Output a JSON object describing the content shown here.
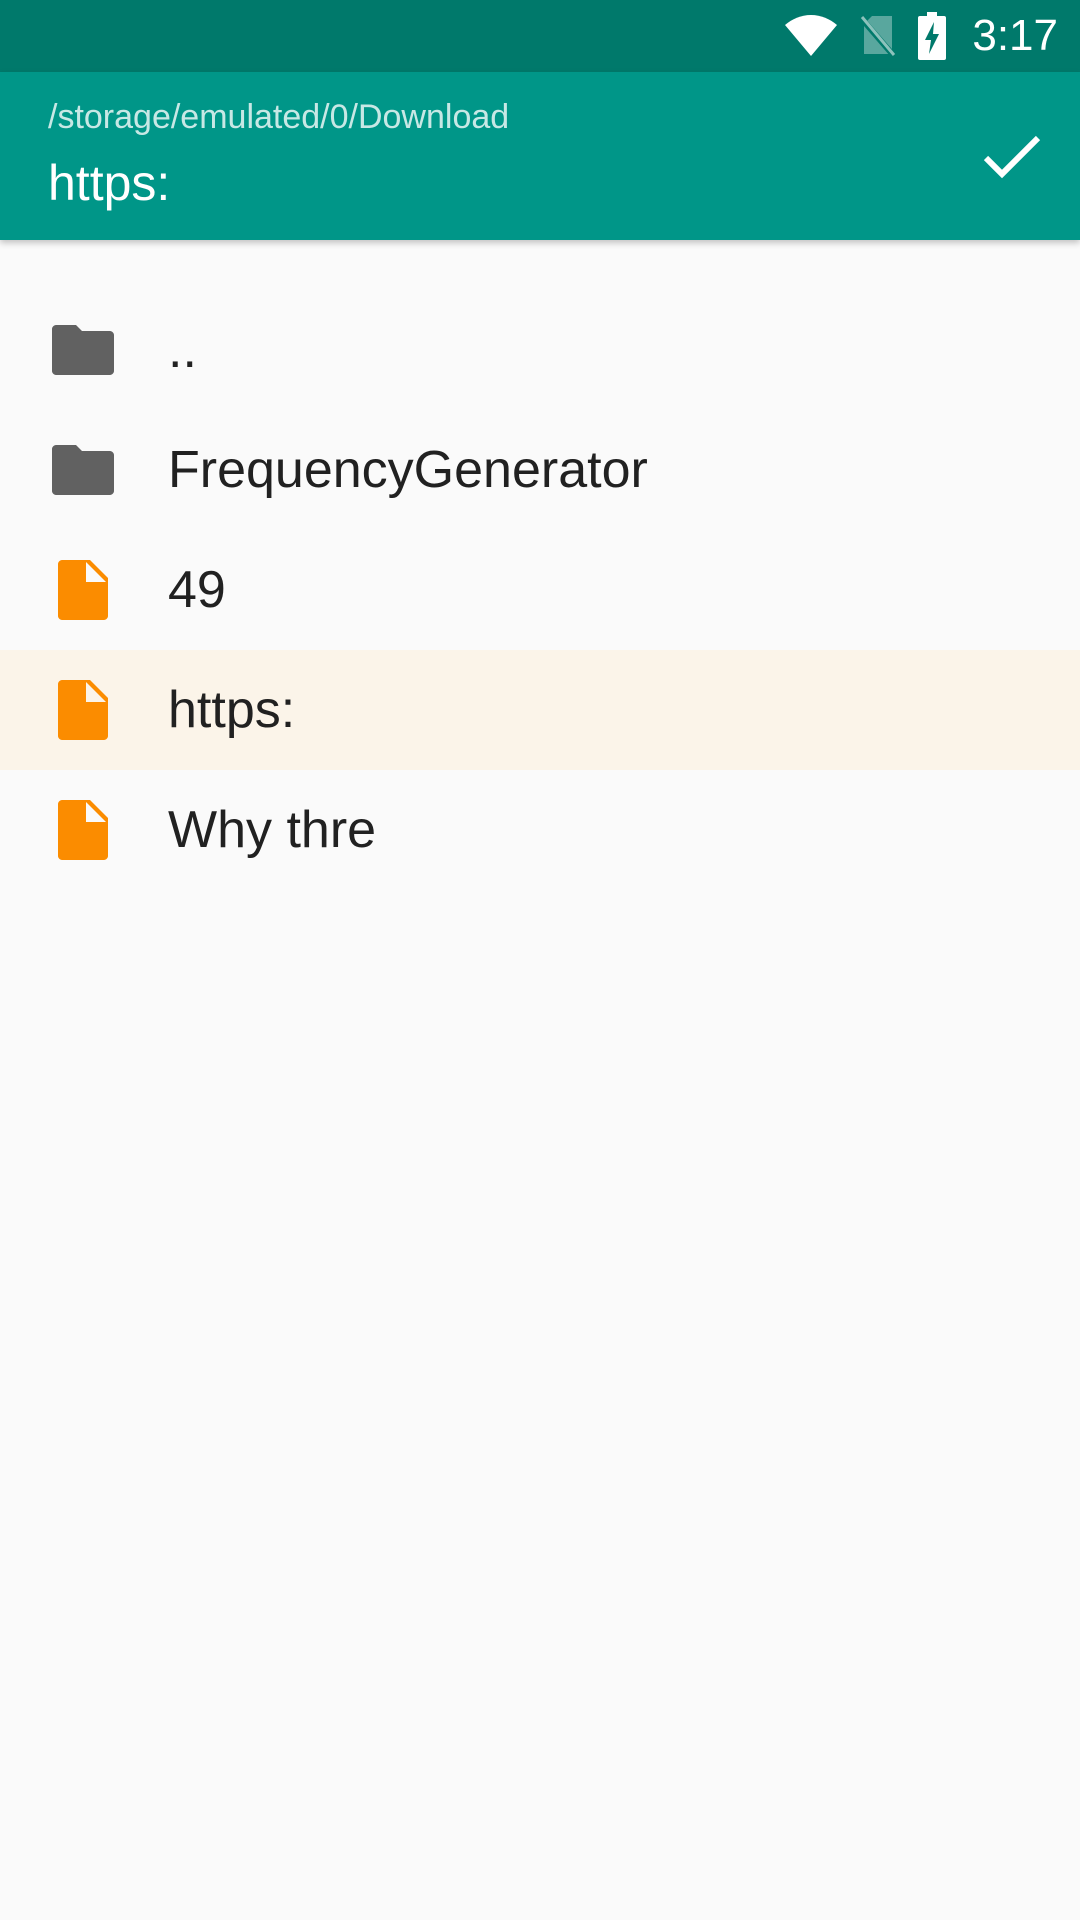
{
  "status_bar": {
    "time": "3:17",
    "icons": [
      "wifi-icon",
      "no-sim-icon",
      "battery-charging-icon"
    ],
    "background": "#00796b"
  },
  "app_bar": {
    "path": "/storage/emulated/0/Download",
    "title": "https:",
    "confirm_icon": "check-icon",
    "background": "#009688"
  },
  "files": [
    {
      "label": "..",
      "type": "folder",
      "icon": "folder-icon",
      "selected": false
    },
    {
      "label": "FrequencyGenerator",
      "type": "folder",
      "icon": "folder-icon",
      "selected": false
    },
    {
      "label": "49",
      "type": "file",
      "icon": "file-icon",
      "selected": false
    },
    {
      "label": "https:",
      "type": "file",
      "icon": "file-icon",
      "selected": true
    },
    {
      "label": "Why thre",
      "type": "file",
      "icon": "file-icon",
      "selected": false
    }
  ],
  "colors": {
    "folder": "#616161",
    "file": "#fb8c00",
    "selected_row": "#fbf4e9"
  }
}
